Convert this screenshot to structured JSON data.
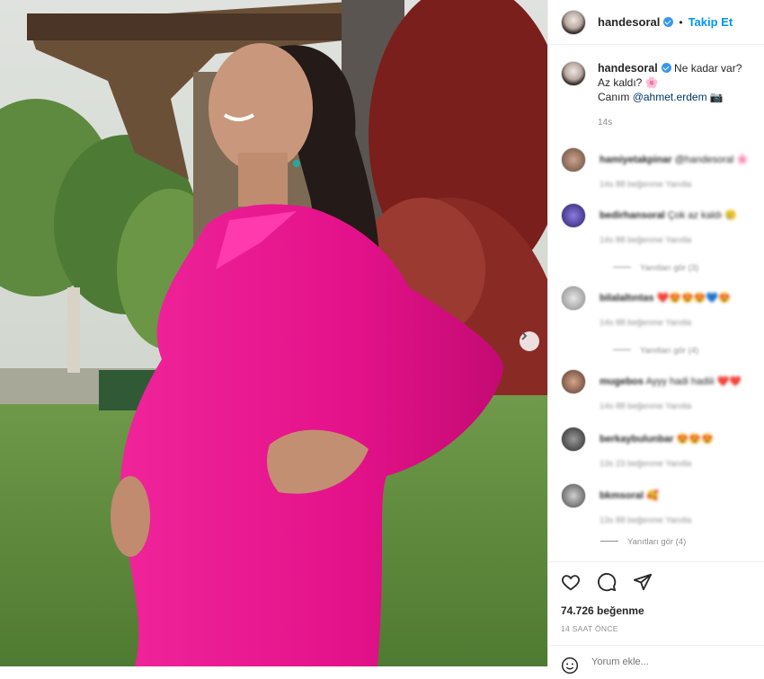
{
  "post": {
    "username": "handesoral",
    "follow_label": "Takip Et",
    "separator": "•",
    "caption_line1": "Ne kadar var?",
    "caption_line2": "Az kaldı? 🌸",
    "caption_line3_prefix": "Canım ",
    "caption_mention": "@ahmet.erdem",
    "caption_line3_suffix": " 📷",
    "time": "14s",
    "likes": "74.726 beğenme",
    "posted_ago": "14 SAAT ÖNCE",
    "comment_placeholder": "Yorum ekle..."
  },
  "comments": [
    {
      "user": "hamiyetakpinar",
      "text": "@handesoral 🌸",
      "meta": "14s   88 beğenme   Yanıtla"
    },
    {
      "user": "bedirhansoral",
      "text": "Çok az kaldı 🥲",
      "meta": "14s   88 beğenme   Yanıtla",
      "replies": "Yanıtları gör (3)"
    },
    {
      "user": "bilalaltıntas",
      "text": "❤️😍😍😍💙😍",
      "meta": "14s   88 beğenme   Yanıtla",
      "replies": "Yanıtları gör (4)"
    },
    {
      "user": "mugebos",
      "text": "Ayyy hadi hadiii ❤️❤️",
      "meta": "14s   88 beğenme   Yanıtla"
    },
    {
      "user": "berkaybulunbar",
      "text": "😍😍😍",
      "meta": "13s   23 beğenme   Yanıtla"
    },
    {
      "user": "bkmsoral",
      "text": "🥰",
      "meta": "13s   88 beğenme   Yanıtla"
    }
  ],
  "last_replies": "Yanıtları gör (4)",
  "colors": {
    "accent": "#0095f6",
    "dress": "#e8168a",
    "verified": "#3897f0"
  },
  "icons": [
    "heart-icon",
    "comment-icon",
    "share-icon",
    "smile-icon",
    "chevron-right-icon"
  ]
}
